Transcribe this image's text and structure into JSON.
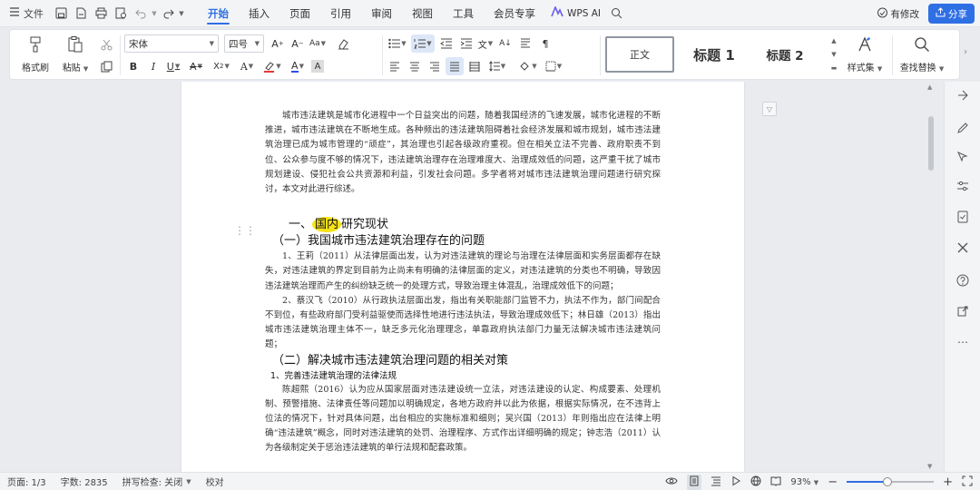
{
  "titlebar": {
    "file_menu": "文件",
    "tabs": [
      {
        "label": "开始",
        "active": true
      },
      {
        "label": "插入",
        "active": false
      },
      {
        "label": "页面",
        "active": false
      },
      {
        "label": "引用",
        "active": false
      },
      {
        "label": "审阅",
        "active": false
      },
      {
        "label": "视图",
        "active": false
      },
      {
        "label": "工具",
        "active": false
      },
      {
        "label": "会员专享",
        "active": false
      }
    ],
    "wps_ai": "WPS AI",
    "revision": "有修改",
    "share": "分享",
    "accent_color": "#2f6fe4"
  },
  "ribbon": {
    "format_painter": "格式刷",
    "paste": "粘贴",
    "font_name": "宋体",
    "font_size": "四号",
    "style_normal": "正文",
    "style_h1": "标题 1",
    "style_h2": "标题 2",
    "styles_set": "样式集",
    "find_replace": "查找替换"
  },
  "document": {
    "intro": "城市违法建筑是城市化进程中一个日益突出的问题，随着我国经济的飞速发展，城市化进程的不断推进，城市违法建筑在不断地生成。各种频出的违法建筑阻碍着社会经济发展和城市规划，城市违法建筑治理已成为城市管理的“顽症”，其治理也引起各级政府重视。但在相关立法不完善、政府职责不到位、公众参与度不够的情况下，违法建筑治理存在治理难度大、治理成效低的问题，这严重干扰了城市规划建设、侵犯社会公共资源和利益，引发社会问题。多学者将对城市违法建筑治理问题进行研究探讨，本文对此进行综述。",
    "heading1_prefix": "一、",
    "heading1_highlight": "国内",
    "heading1_suffix": "研究现状",
    "heading2a": "（一）我国城市违法建筑治理存在的问题",
    "para1": "1、王莉（2011）从法律层面出发，认为对违法建筑的理论与治理在法律层面和实务层面都存在缺失，对违法建筑的界定到目前为止尚未有明确的法律层面的定义，对违法建筑的分类也不明确，导致因违法建筑治理而产生的纠纷缺乏统一的处理方式，导致治理主体混乱，治理成效低下的问题；",
    "para2": "2、蔡汉飞（2010）从行政执法层面出发，指出有关职能部门监管不力，执法不作为，部门间配合不到位，有些政府部门受利益驱使而选择性地进行违法执法，导致治理成效低下；林日雄（2013）指出城市违法建筑治理主体不一，缺乏多元化治理理念，单靠政府执法部门力量无法解决城市违法建筑问题；",
    "heading2b": "（二）解决城市违法建筑治理问题的相关对策",
    "heading3": "1、完善违法建筑治理的法律法规",
    "para3": "陈超熙（2016）认为应从国家层面对违法建设统一立法，对违法建设的认定、构成要素、处理机制、预警措施、法律责任等问题加以明确规定，各地方政府并以此为依据，根据实际情况，在不违背上位法的情况下，针对具体问题，出台相应的实施标准和细则；吴兴国（2013）年则指出应在法律上明确“违法建筑”概念，同时对违法建筑的处罚、治理程序、方式作出详细明确的规定；钟志浩（2011）认为各级制定关于惩治违法建筑的单行法规和配套政策。"
  },
  "statusbar": {
    "page": "页面: 1/3",
    "words": "字数: 2835",
    "spell": "拼写检查: 关闭",
    "proofread": "校对",
    "zoom": "93%",
    "zoom_fraction": 0.47
  }
}
